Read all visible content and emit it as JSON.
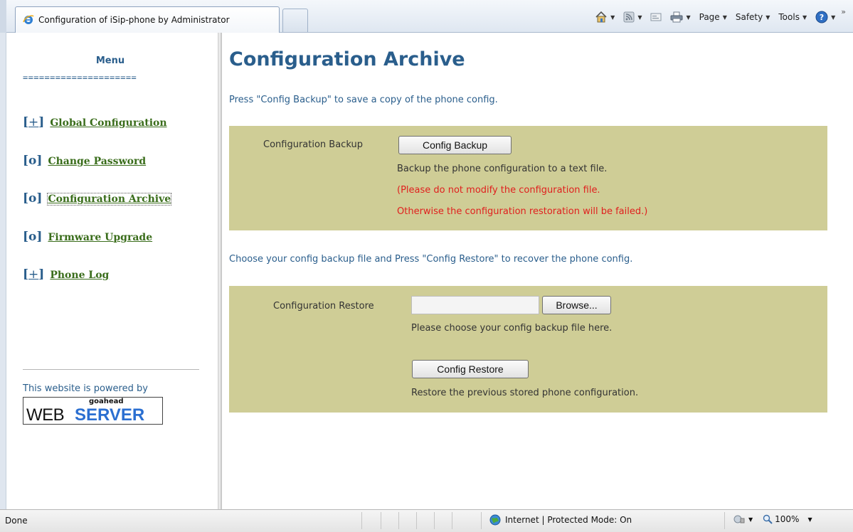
{
  "browser": {
    "tab_title": "Configuration of iSip-phone by Administrator",
    "commands": {
      "page": "Page",
      "safety": "Safety",
      "tools": "Tools",
      "more": "»"
    }
  },
  "sidebar": {
    "menu_title": "Menu",
    "menu_rule": "=====================",
    "items": [
      {
        "marker": "[+]",
        "label": "Global Configuration"
      },
      {
        "marker": "[o]",
        "label": "Change Password"
      },
      {
        "marker": "[o]",
        "label": "Configuration Archive"
      },
      {
        "marker": "[o]",
        "label": "Firmware Upgrade"
      },
      {
        "marker": "[+]",
        "label": "Phone Log"
      }
    ],
    "powered_text": "This website is powered by",
    "logo": {
      "small": "goahead",
      "web": "WEB",
      "server": "SERVER"
    }
  },
  "main": {
    "title": "Configuration Archive",
    "backup_intro": "Press \"Config Backup\" to save a copy of the phone config.",
    "backup": {
      "label": "Configuration Backup",
      "button": "Config Backup",
      "desc": "Backup the phone configuration to a text file.",
      "warn_line1": "(Please do not modify the configuration file.",
      "warn_line2": "Otherwise the configuration restoration will be failed.)"
    },
    "restore_intro": "Choose your config backup file and Press \"Config Restore\" to recover the phone config.",
    "restore": {
      "label": "Configuration Restore",
      "file_value": "",
      "browse_button": "Browse...",
      "file_hint": "Please choose your config backup file here.",
      "button": "Config Restore",
      "desc": "Restore the previous stored phone configuration."
    }
  },
  "status_bar": {
    "left": "Done",
    "zone": "Internet | Protected Mode: On",
    "zoom": "100%"
  },
  "colors": {
    "accent_blue": "#2a5e8c",
    "link_green": "#3a6d1b",
    "panel": "#cfcd96",
    "warning_red": "#e0201e"
  }
}
